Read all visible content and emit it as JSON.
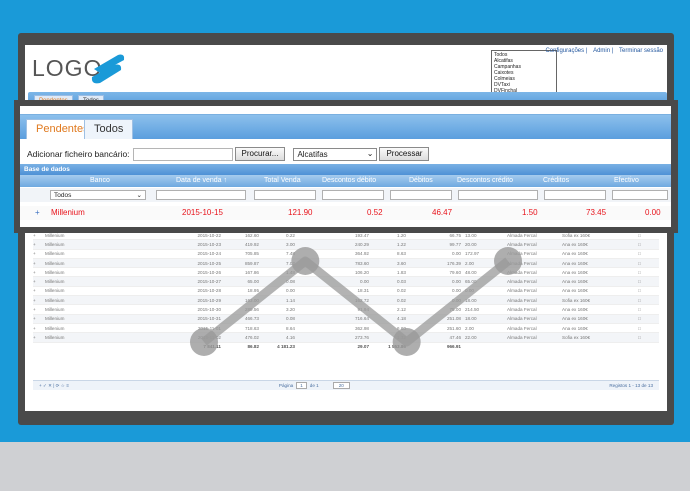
{
  "app": {
    "logo_text": "LOGO",
    "top_links": [
      "Configurações",
      "Admin",
      "Terminar sessão"
    ],
    "dropdown_options": [
      "Todos",
      "Alcatifas",
      "Campanhas",
      "Caixotes",
      "Colmeias",
      "DVTaxi",
      "DVFinchal",
      "Diferenças",
      "Cheques"
    ]
  },
  "tabs": [
    {
      "label": "Pendentes",
      "active": true
    },
    {
      "label": "Todos",
      "active": false
    }
  ],
  "upload": {
    "label": "Adicionar ficheiro bancário:",
    "browse_label": "Procurar...",
    "select_value": "Alcatifas",
    "process_label": "Processar"
  },
  "grid": {
    "title": "Base de dados",
    "columns": [
      "Banco",
      "Data de venda ↑",
      "Total Venda",
      "Descontos débito",
      "Débitos",
      "Descontos crédito",
      "Créditos",
      "Efectivo"
    ],
    "filter_value": "Todos",
    "highlight_row": {
      "banco": "Millenium",
      "data": "2015-10-15",
      "total": "121.90",
      "desc_debito": "0.52",
      "debitos": "46.47",
      "desc_credito": "1.50",
      "creditos": "73.45",
      "efectivo": "0.00"
    },
    "rows": [
      [
        "Millenium",
        "2015-10-22",
        "162.60",
        "0.22",
        "193.47",
        "1.20",
        "66.75",
        "13.00",
        "Almada Fercal",
        "Sofia ex 160€"
      ],
      [
        "Millenium",
        "2015-10-23",
        "419.92",
        "3.00",
        "240.29",
        "1.22",
        "99.77",
        "20.00",
        "Almada Fercal",
        "Ana ex 160€"
      ],
      [
        "Millenium",
        "2015-10-24",
        "705.85",
        "7.48",
        "364.92",
        "8.63",
        "0.00",
        "172.97",
        "Almada Fercal",
        "Ana ex 160€"
      ],
      [
        "Millenium",
        "2015-10-25",
        "859.87",
        "7.02",
        "783.60",
        "3.60",
        "176.39",
        "2.00",
        "Almada Fercal",
        "Ana ex 160€"
      ],
      [
        "Millenium",
        "2015-10-26",
        "167.86",
        "1.48",
        "106.20",
        "1.83",
        "79.60",
        "48.00",
        "Almada Fercal",
        "Ana ex 160€"
      ],
      [
        "Millenium",
        "2015-10-27",
        "65.00",
        "0.08",
        "0.00",
        "0.03",
        "0.00",
        "65.00",
        "Almada Fercal",
        "Ana ex 160€"
      ],
      [
        "Millenium",
        "2015-10-28",
        "18.95",
        "0.00",
        "18.31",
        "0.02",
        "0.00",
        "0.00",
        "Almada Fercal",
        "Ana ex 160€"
      ],
      [
        "Millenium",
        "2015-10-29",
        "163.00",
        "1.14",
        "162.72",
        "0.02",
        "0.00",
        "18.00",
        "Almada Fercal",
        "Sofia ex 160€"
      ],
      [
        "Millenium",
        "2015-10-30",
        "289.56",
        "3.20",
        "91.94",
        "2.12",
        "75.00",
        "214.50",
        "Almada Fercal",
        "Ana ex 160€"
      ],
      [
        "Millenium",
        "2015-10-31",
        "466.73",
        "0.08",
        "716.64",
        "4.18",
        "251.08",
        "18.00",
        "Almada Fercal",
        "Ana ex 160€"
      ],
      [
        "Millenium",
        "2015-11-01",
        "718.63",
        "8.64",
        "362.98",
        "6.60",
        "251.60",
        "2.00",
        "Almada Fercal",
        "Ana ex 160€"
      ],
      [
        "Millenium",
        "2015-11-02",
        "476.02",
        "4.16",
        "273.76",
        "1.32",
        "47.46",
        "22.00",
        "Almada Fercal",
        "Sofia ex 160€"
      ]
    ],
    "totals": [
      "7 841.11",
      "86.82",
      "4 181.23",
      "29.07",
      "1 553.86",
      "966.91"
    ],
    "pager": {
      "icons": "+ ✓ ✕ | ⟳ ☆ ≡",
      "page_label": "Página",
      "page_value": "1",
      "of_label": "de 1",
      "page_size": "20",
      "records": "Registos 1 - 13 de 13"
    }
  },
  "colors": {
    "background": "#1a9ad8",
    "bezel": "#4a4a4a",
    "accent_orange": "#e07a1f",
    "highlight_red": "#e8141c",
    "header_blue": "#5b9ede"
  },
  "chart_data": {
    "type": "line",
    "x": [
      1,
      2,
      3,
      4
    ],
    "series": [
      {
        "values": [
          1,
          3,
          1,
          3
        ]
      }
    ]
  }
}
